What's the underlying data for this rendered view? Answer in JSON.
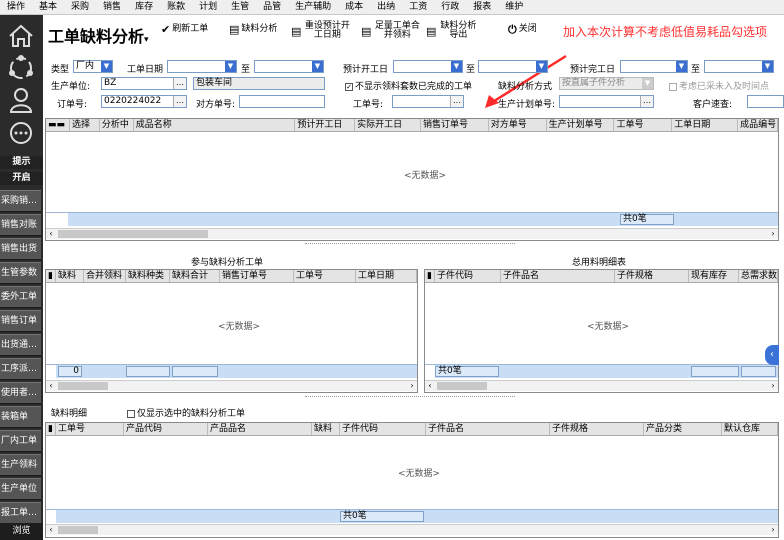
{
  "menu": [
    "操作",
    "基本",
    "采购",
    "销售",
    "库存",
    "账款",
    "计划",
    "生管",
    "品管",
    "生产辅助",
    "成本",
    "出纳",
    "工资",
    "行政",
    "报表",
    "维护"
  ],
  "sidebar": {
    "icons": [
      "home-icon",
      "network-icon",
      "user-icon",
      "chat-icon"
    ],
    "tip": "提示",
    "open": "开启",
    "items": [
      "采购销…",
      "销售对账",
      "销售出货",
      "生管参数",
      "委外工单",
      "销售订单",
      "出货通…",
      "工序派…",
      "使用者…",
      "装箱单",
      "厂内工单",
      "生产领料",
      "生产单位",
      "报工单…"
    ],
    "footer": "浏览"
  },
  "header": {
    "title": "工单缺料分析",
    "title_arrow": "▾",
    "buttons": [
      {
        "icon": "✔",
        "label": "刷新工单",
        "name": "refresh-button"
      },
      {
        "icon": "▤",
        "label": "缺料分析",
        "name": "shortage-analysis-button"
      },
      {
        "icon": "▤",
        "label": "重设预计开工日期",
        "name": "reset-start-date-button"
      },
      {
        "icon": "▤",
        "label": "足量工单合并领料",
        "name": "merge-picking-button"
      },
      {
        "icon": "▤",
        "label": "缺料分析导出",
        "name": "export-button"
      },
      {
        "icon": "⏻",
        "label": "关闭",
        "name": "close-button"
      }
    ]
  },
  "annotation": "加入本次计算不考虑低值易耗品勾选项",
  "filters": {
    "type_label": "类型",
    "type_value": "厂内",
    "wo_date_label": "工单日期",
    "to_label": "至",
    "est_start_label": "预计开工日",
    "est_finish_label": "预计完工日",
    "prod_unit_label": "生产单位:",
    "prod_unit_value": "BZ",
    "prod_unit_name": "包装车间",
    "hide_done_label": "不显示领料套数已完成的工单",
    "method_label": "缺料分析方式",
    "method_value": "按直属子件分析",
    "consider_label": "考虑已采未入及时间点",
    "order_label": "订单号:",
    "order_value": "0220224022",
    "cust_order_label": "对方单号:",
    "wo_no_label": "工单号:",
    "plan_no_label": "生产计划单号:",
    "cust_label": "客户速查:"
  },
  "top_grid": {
    "columns": [
      "选择",
      "分析中",
      "成品名称",
      "预计开工日",
      "实际开工日",
      "销售订单号",
      "对方单号",
      "生产计划单号",
      "工单号",
      "工单日期",
      "成品编号"
    ],
    "empty": "<无数据>",
    "footer_count": "共0笔"
  },
  "left_panel": {
    "title": "参与缺料分析工单",
    "columns": [
      "缺料",
      "合并领料",
      "缺料种类",
      "缺料合计",
      "销售订单号",
      "工单号",
      "工单日期"
    ],
    "empty": "<无数据>",
    "footer_count": "0"
  },
  "right_panel": {
    "title": "总用料明细表",
    "columns": [
      "子件代码",
      "子件品名",
      "子件规格",
      "现有库存",
      "总需求数"
    ],
    "empty": "<无数据>",
    "footer_count": "共0笔"
  },
  "bottom": {
    "title": "缺料明细",
    "only_selected_label": "仅显示选中的缺料分析工单",
    "columns": [
      "工单号",
      "产品代码",
      "产品品名",
      "缺料",
      "子件代码",
      "子件品名",
      "子件规格",
      "产品分类",
      "默认仓库"
    ],
    "empty": "<无数据>",
    "footer_count": "共0笔"
  },
  "colors": {
    "sidebar_bg": "#2b2b2b",
    "grid_footer": "#c9ddf4",
    "annotation": "#ff3030",
    "accent": "#3a72d8"
  }
}
